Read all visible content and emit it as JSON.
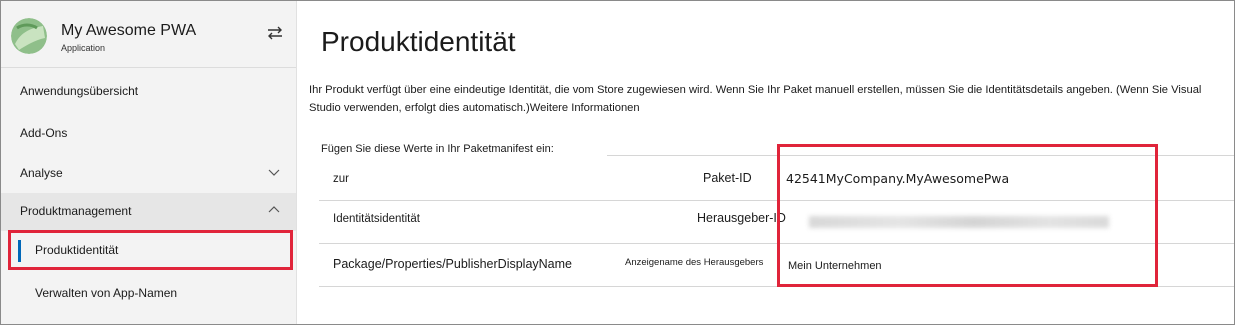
{
  "app": {
    "name": "My Awesome PWA",
    "subtitle": "Application",
    "switch_icon": "swap-arrows-icon"
  },
  "sidebar": {
    "items": [
      {
        "label": "Anwendungsübersicht"
      },
      {
        "label": "Add-Ons"
      },
      {
        "label": "Analyse",
        "chevron": "down"
      },
      {
        "label": "Produktmanagement",
        "chevron": "up",
        "expanded": true
      },
      {
        "label": "Produktidentität",
        "selected": true
      },
      {
        "label": "Verwalten von App-Namen"
      }
    ]
  },
  "main": {
    "title": "Produktidentität",
    "description": "Ihr Produkt verfügt über eine eindeutige Identität, die vom Store zugewiesen wird. Wenn Sie Ihr Paket manuell erstellen, müssen Sie die Identitätsdetails angeben. (Wenn Sie Visual Studio verwenden, erfolgt dies automatisch.)",
    "more_link": "Weitere Informationen",
    "instruction": "Fügen Sie diese Werte in Ihr Paketmanifest ein:",
    "rows": [
      {
        "manifest": "zur",
        "field": "Paket-ID",
        "value": "42541MyCompany.MyAwesomePwa"
      },
      {
        "manifest": "Identitätsidentität",
        "field": "Herausgeber-ID",
        "value": ""
      },
      {
        "manifest": "Package/Properties/PublisherDisplayName",
        "field": "Anzeigename des Herausgebers",
        "value": "Mein Unternehmen"
      }
    ]
  },
  "colors": {
    "accent": "#0067b8",
    "highlight": "#e0243a",
    "sidebar_bg": "#f3f3f3"
  }
}
